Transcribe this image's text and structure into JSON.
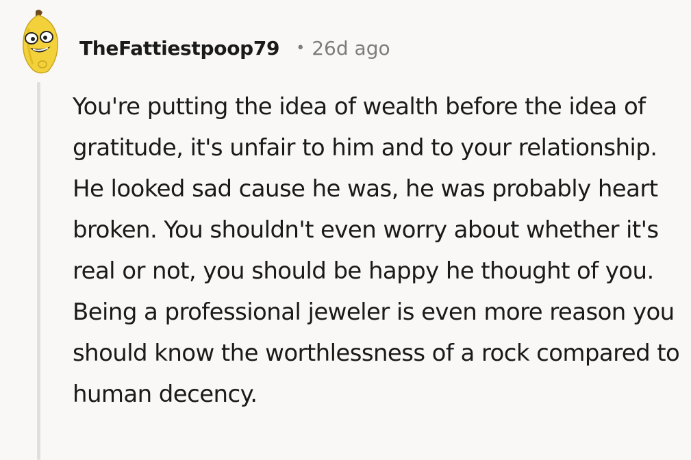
{
  "comment": {
    "username": "TheFattiestpoop79",
    "separator": "•",
    "timestamp": "26d ago",
    "avatar_icon": "banana-avatar-icon",
    "body": "You're putting the idea of wealth before the idea of gratitude, it's unfair to him and to your relationship. He looked sad cause he was, he was probably heart broken. You shouldn't even worry about whether it's real or not, you should be happy he thought of you. Being a professional jeweler is even more reason you should know the worthlessness of a rock compared to human decency."
  },
  "colors": {
    "background": "#f9f8f6",
    "text": "#1a1a1b",
    "muted": "#7c7c7c",
    "thread_line": "#e0dfdc",
    "avatar_yellow": "#f2d13a"
  }
}
